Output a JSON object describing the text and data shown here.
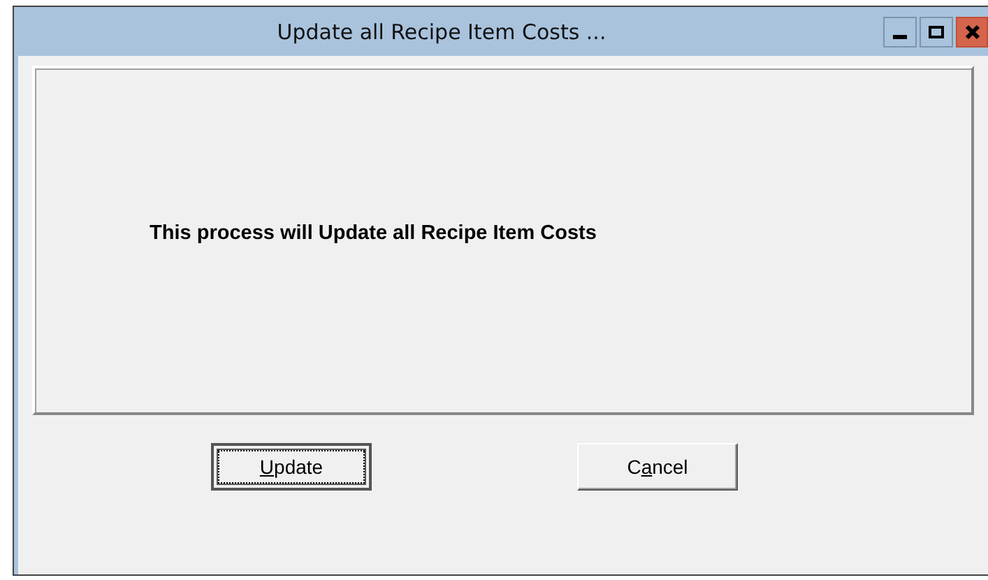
{
  "window": {
    "title": "Update all Recipe Item Costs ..."
  },
  "message": "This process will Update all Recipe Item Costs",
  "buttons": [
    {
      "access_key": "U",
      "post": "pdate",
      "focused": true
    },
    {
      "pre": "C",
      "access_key": "a",
      "post": "ncel",
      "focused": false
    }
  ]
}
